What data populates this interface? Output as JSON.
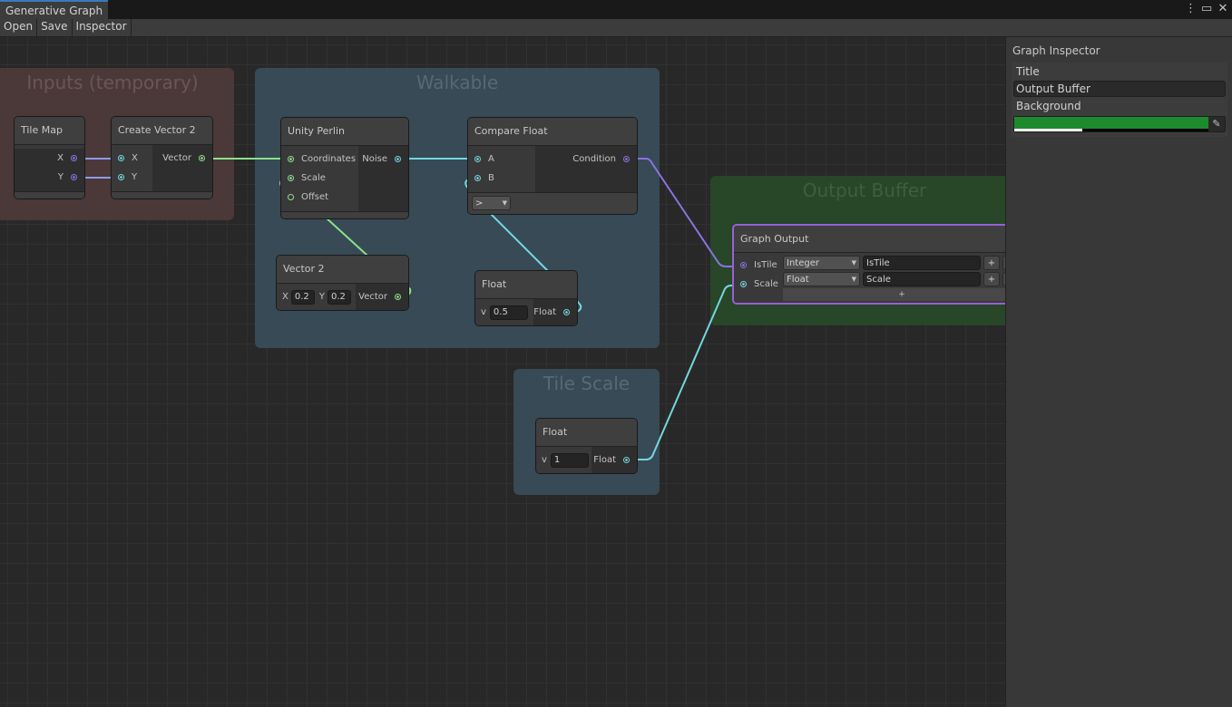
{
  "window": {
    "tab_title": "Generative Graph",
    "controls": [
      "more-icon",
      "maximize-icon",
      "close-icon"
    ]
  },
  "toolbar": {
    "open_label": "Open",
    "save_label": "Save",
    "inspector_label": "Inspector"
  },
  "groups": {
    "inputs": "Inputs (temporary)",
    "walkable": "Walkable",
    "tile_scale": "Tile Scale",
    "output_buffer": "Output Buffer"
  },
  "nodes": {
    "tile_map": {
      "title": "Tile Map",
      "outputs": [
        "X",
        "Y"
      ]
    },
    "create_vector2": {
      "title": "Create Vector 2",
      "inputs": [
        "X",
        "Y"
      ],
      "outputs": [
        "Vector"
      ]
    },
    "unity_perlin": {
      "title": "Unity Perlin",
      "inputs": [
        "Coordinates",
        "Scale",
        "Offset"
      ],
      "outputs": [
        "Noise"
      ]
    },
    "compare_float": {
      "title": "Compare Float",
      "inputs": [
        "A",
        "B"
      ],
      "outputs": [
        "Condition"
      ],
      "operator": ">"
    },
    "vector2": {
      "title": "Vector 2",
      "x_label": "X",
      "x_value": "0.2",
      "y_label": "Y",
      "y_value": "0.2",
      "output": "Vector"
    },
    "float_walk": {
      "title": "Float",
      "v_label": "v",
      "value": "0.5",
      "output": "Float"
    },
    "float_tile": {
      "title": "Float",
      "v_label": "v",
      "value": "1",
      "output": "Float"
    },
    "graph_output": {
      "title": "Graph Output",
      "rows": [
        {
          "port": "IsTile",
          "type": "Integer",
          "name": "IsTile",
          "add": "+"
        },
        {
          "port": "Scale",
          "type": "Float",
          "name": "Scale",
          "add": "+"
        }
      ],
      "add_row": "+"
    }
  },
  "inspector": {
    "title": "Graph Inspector",
    "title_label": "Title",
    "title_value": "Output Buffer",
    "background_label": "Background",
    "background_color": "#1e8a2e",
    "background_alpha": 0.35
  },
  "colors": {
    "int_port": "#8b73e0",
    "float_port": "#74d6e0",
    "vector_port": "#8ee08a",
    "selection": "#9a5fd6"
  }
}
